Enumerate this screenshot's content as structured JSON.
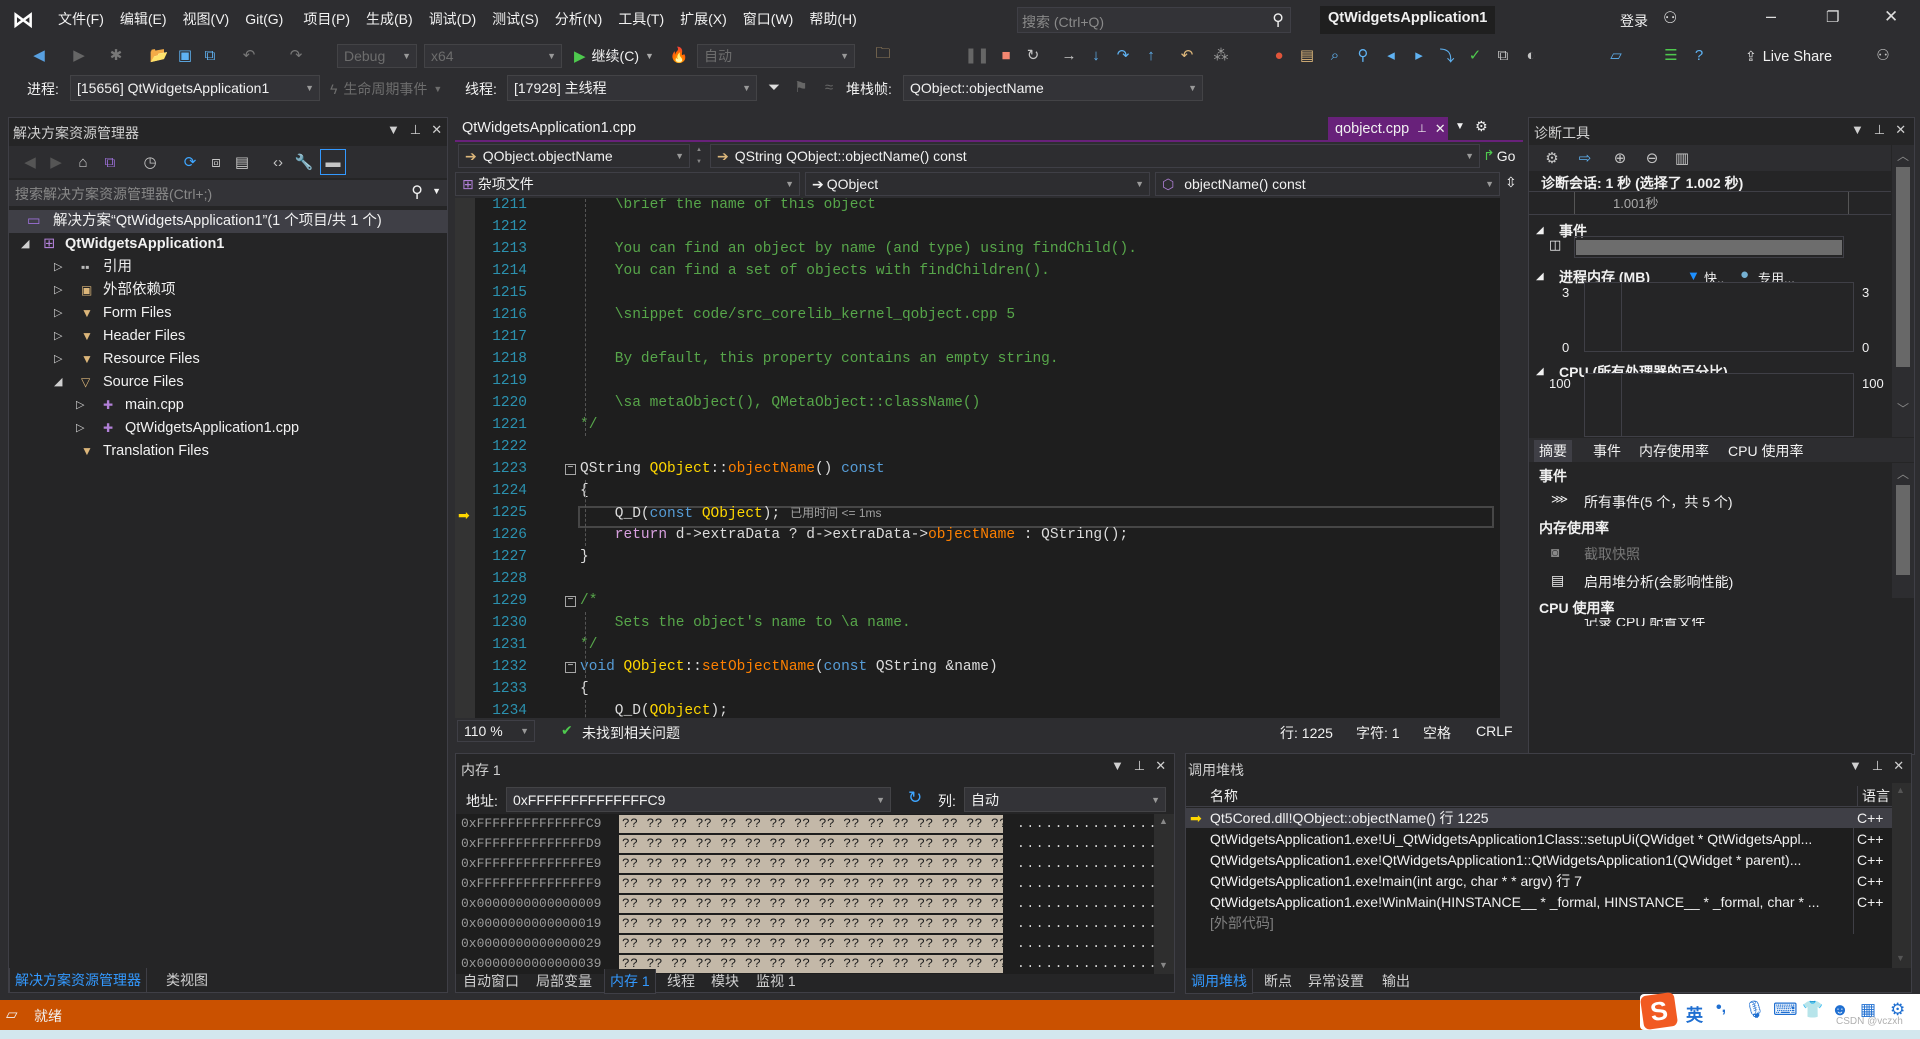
{
  "app": {
    "title": "QtWidgetsApplication1",
    "login": "登录",
    "search_placeholder": "搜索 (Ctrl+Q)"
  },
  "menu": [
    "文件(F)",
    "编辑(E)",
    "视图(V)",
    "Git(G)",
    "项目(P)",
    "生成(B)",
    "调试(D)",
    "测试(S)",
    "分析(N)",
    "工具(T)",
    "扩展(X)",
    "窗口(W)",
    "帮助(H)"
  ],
  "toolbar": {
    "config": "Debug",
    "platform": "x64",
    "continue": "继续(C)",
    "auto": "自动",
    "live_share": "Live Share"
  },
  "debug_location": {
    "process_label": "进程:",
    "process": "[15656] QtWidgetsApplication1",
    "lifecycle": "生命周期事件",
    "thread_label": "线程:",
    "thread": "[17928] 主线程",
    "stack_label": "堆栈帧:",
    "stack": "QObject::objectName"
  },
  "solution_explorer": {
    "title": "解决方案资源管理器",
    "search_placeholder": "搜索解决方案资源管理器(Ctrl+;)",
    "solution": "解决方案“QtWidgetsApplication1”(1 个项目/共 1 个)",
    "project": "QtWidgetsApplication1",
    "items": [
      {
        "label": "引用",
        "level": 1,
        "expander": "collapsed",
        "icon": "reference"
      },
      {
        "label": "外部依赖项",
        "level": 1,
        "expander": "collapsed",
        "icon": "external-deps"
      },
      {
        "label": "Form Files",
        "level": 1,
        "expander": "collapsed",
        "icon": "filter-folder"
      },
      {
        "label": "Header Files",
        "level": 1,
        "expander": "collapsed",
        "icon": "filter-folder"
      },
      {
        "label": "Resource Files",
        "level": 1,
        "expander": "collapsed",
        "icon": "filter-folder"
      },
      {
        "label": "Source Files",
        "level": 1,
        "expander": "expanded",
        "icon": "filter-folder-open"
      },
      {
        "label": "main.cpp",
        "level": 2,
        "expander": "collapsed",
        "icon": "cpp-file"
      },
      {
        "label": "QtWidgetsApplication1.cpp",
        "level": 2,
        "expander": "collapsed",
        "icon": "cpp-file"
      },
      {
        "label": "Translation Files",
        "level": 1,
        "expander": "none",
        "icon": "filter-folder"
      }
    ],
    "tabs": [
      "解决方案资源管理器",
      "类视图"
    ]
  },
  "editor": {
    "tabs": [
      {
        "label": "QtWidgetsApplication1.cpp",
        "active": false
      },
      {
        "label": "qobject.cpp",
        "active": true
      }
    ],
    "nav": {
      "scope": "QObject.objectName",
      "function": "QString QObject::objectName() const",
      "go": "Go",
      "project": "杂项文件",
      "class": "QObject",
      "member": "objectName() const"
    },
    "current_line": 1225,
    "hint": "已用时间 <= 1ms",
    "lines": [
      {
        "n": "1211",
        "t": [
          [
            "c",
            "    \\brief the name of this object"
          ]
        ]
      },
      {
        "n": "1212",
        "t": []
      },
      {
        "n": "1213",
        "t": [
          [
            "c",
            "    You can find an object by name (and type) using findChild()."
          ]
        ]
      },
      {
        "n": "1214",
        "t": [
          [
            "c",
            "    You can find a set of objects with findChildren()."
          ]
        ]
      },
      {
        "n": "1215",
        "t": []
      },
      {
        "n": "1216",
        "t": [
          [
            "c",
            "    \\snippet code/src_corelib_kernel_qobject.cpp 5"
          ]
        ]
      },
      {
        "n": "1217",
        "t": []
      },
      {
        "n": "1218",
        "t": [
          [
            "c",
            "    By default, this property contains an empty string."
          ]
        ]
      },
      {
        "n": "1219",
        "t": []
      },
      {
        "n": "1220",
        "t": [
          [
            "c",
            "    \\sa metaObject(), QMetaObject::className()"
          ]
        ]
      },
      {
        "n": "1221",
        "t": [
          [
            "c",
            "*/"
          ]
        ]
      },
      {
        "n": "1222",
        "t": []
      },
      {
        "n": "1223",
        "fold": true,
        "t": [
          [
            "p",
            "QString "
          ],
          [
            "y",
            "QObject"
          ],
          [
            "p",
            "::"
          ],
          [
            "o",
            "objectName"
          ],
          [
            "p",
            "() "
          ],
          [
            "k",
            "const"
          ]
        ]
      },
      {
        "n": "1224",
        "t": [
          [
            "p",
            "{"
          ]
        ]
      },
      {
        "n": "1225",
        "t": [
          [
            "p",
            "    Q_D("
          ],
          [
            "k",
            "const "
          ],
          [
            "y",
            "QObject"
          ],
          [
            "p",
            ");"
          ]
        ]
      },
      {
        "n": "1226",
        "t": [
          [
            "r",
            "    return "
          ],
          [
            "p",
            "d->extraData ? d->extraData->"
          ],
          [
            "o",
            "objectName"
          ],
          [
            "p",
            " : QString();"
          ]
        ]
      },
      {
        "n": "1227",
        "t": [
          [
            "p",
            "}"
          ]
        ]
      },
      {
        "n": "1228",
        "t": []
      },
      {
        "n": "1229",
        "fold": true,
        "t": [
          [
            "c",
            "/*"
          ]
        ]
      },
      {
        "n": "1230",
        "t": [
          [
            "c",
            "    Sets the object's name to \\a name."
          ]
        ]
      },
      {
        "n": "1231",
        "t": [
          [
            "c",
            "*/"
          ]
        ]
      },
      {
        "n": "1232",
        "fold": true,
        "t": [
          [
            "k",
            "void "
          ],
          [
            "y",
            "QObject"
          ],
          [
            "p",
            "::"
          ],
          [
            "o",
            "setObjectName"
          ],
          [
            "p",
            "("
          ],
          [
            "k",
            "const "
          ],
          [
            "p",
            "QString &name)"
          ]
        ]
      },
      {
        "n": "1233",
        "t": [
          [
            "p",
            "{"
          ]
        ]
      },
      {
        "n": "1234",
        "t": [
          [
            "p",
            "    Q_D("
          ],
          [
            "y",
            "QObject"
          ],
          [
            "p",
            ");"
          ]
        ]
      }
    ],
    "status": {
      "zoom": "110 %",
      "issues": "未找到相关问题",
      "line": "行: 1225",
      "char": "字符: 1",
      "spaces": "空格",
      "eol": "CRLF"
    }
  },
  "memory": {
    "title": "内存 1",
    "address_label": "地址:",
    "address": "0xFFFFFFFFFFFFFFC9",
    "columns_label": "列:",
    "columns": "自动",
    "rows": [
      {
        "addr": "0xFFFFFFFFFFFFFFC9",
        "hex": "?? ?? ?? ?? ?? ?? ?? ?? ?? ?? ?? ?? ?? ?? ?? ??",
        "ascii": "................"
      },
      {
        "addr": "0xFFFFFFFFFFFFFFD9",
        "hex": "?? ?? ?? ?? ?? ?? ?? ?? ?? ?? ?? ?? ?? ?? ?? ??",
        "ascii": "................"
      },
      {
        "addr": "0xFFFFFFFFFFFFFFE9",
        "hex": "?? ?? ?? ?? ?? ?? ?? ?? ?? ?? ?? ?? ?? ?? ?? ??",
        "ascii": "................"
      },
      {
        "addr": "0xFFFFFFFFFFFFFFF9",
        "hex": "?? ?? ?? ?? ?? ?? ?? ?? ?? ?? ?? ?? ?? ?? ?? ??",
        "ascii": "................"
      },
      {
        "addr": "0x0000000000000009",
        "hex": "?? ?? ?? ?? ?? ?? ?? ?? ?? ?? ?? ?? ?? ?? ?? ??",
        "ascii": "................"
      },
      {
        "addr": "0x0000000000000019",
        "hex": "?? ?? ?? ?? ?? ?? ?? ?? ?? ?? ?? ?? ?? ?? ?? ??",
        "ascii": "................"
      },
      {
        "addr": "0x0000000000000029",
        "hex": "?? ?? ?? ?? ?? ?? ?? ?? ?? ?? ?? ?? ?? ?? ?? ??",
        "ascii": "................"
      },
      {
        "addr": "0x0000000000000039",
        "hex": "?? ?? ?? ?? ?? ?? ?? ?? ?? ?? ?? ?? ?? ?? ?? ??",
        "ascii": "................"
      }
    ],
    "tabs": [
      "自动窗口",
      "局部变量",
      "内存 1",
      "线程",
      "模块",
      "监视 1"
    ],
    "active_tab": 2
  },
  "call_stack": {
    "title": "调用堆栈",
    "headers": {
      "name": "名称",
      "lang": "语言"
    },
    "rows": [
      {
        "name": "Qt5Cored.dll!QObject::objectName() 行 1225",
        "lang": "C++",
        "current": true
      },
      {
        "name": "QtWidgetsApplication1.exe!Ui_QtWidgetsApplication1Class::setupUi(QWidget * QtWidgetsAppl...",
        "lang": "C++"
      },
      {
        "name": "QtWidgetsApplication1.exe!QtWidgetsApplication1::QtWidgetsApplication1(QWidget * parent)...",
        "lang": "C++"
      },
      {
        "name": "QtWidgetsApplication1.exe!main(int argc, char * * argv) 行 7",
        "lang": "C++"
      },
      {
        "name": "QtWidgetsApplication1.exe!WinMain(HINSTANCE__ * _formal, HINSTANCE__ * _formal, char * ...",
        "lang": "C++"
      },
      {
        "name": "[外部代码]",
        "lang": "",
        "external": true
      }
    ],
    "tabs": [
      "调用堆栈",
      "断点",
      "异常设置",
      "输出"
    ],
    "active_tab": 0
  },
  "diagnostics": {
    "title": "诊断工具",
    "session": "诊断会话: 1 秒 (选择了 1.002 秒)",
    "timeline_label": "1.001秒",
    "events_heading": "事件",
    "memory_heading": "进程内存 (MB)",
    "memory_legend": [
      {
        "label": "快..",
        "color": "#1e90ff",
        "shape": "triangle"
      },
      {
        "label": "专用...",
        "color": "#75b0d2",
        "shape": "circle"
      }
    ],
    "memory_axis": {
      "max": "3",
      "min": "0"
    },
    "cpu_heading": "CPU (所有处理器的百分比)",
    "cpu_axis": {
      "max": "100",
      "min": "0"
    },
    "tabs": [
      "摘要",
      "事件",
      "内存使用率",
      "CPU 使用率"
    ],
    "summary": {
      "events_heading": "事件",
      "all_events": "所有事件(5 个，共 5 个)",
      "memory_heading": "内存使用率",
      "snapshot": "截取快照",
      "heap": "启用堆分析(会影响性能)",
      "cpu_heading": "CPU 使用率",
      "cpu_profile": "记录 CPU 配置文件"
    }
  },
  "status_bar": {
    "text": "就绪",
    "color": "#ca5100"
  },
  "ime": {
    "lang": "英",
    "punct": "•,"
  },
  "watermark": "CSDN @vczxh"
}
